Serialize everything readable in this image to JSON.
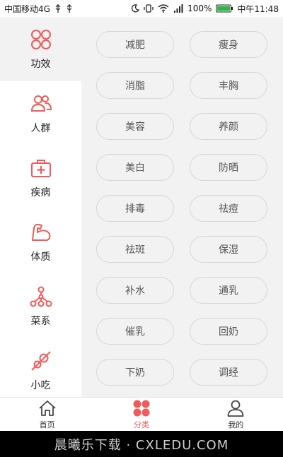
{
  "status_bar": {
    "carrier": "中国移动4G",
    "battery": "100%",
    "time": "中午11:48"
  },
  "sidebar": {
    "items": [
      {
        "label": "功效",
        "icon": "grid-circles-icon",
        "active": true
      },
      {
        "label": "人群",
        "icon": "people-icon"
      },
      {
        "label": "疾病",
        "icon": "medical-kit-icon"
      },
      {
        "label": "体质",
        "icon": "muscle-arm-icon"
      },
      {
        "label": "菜系",
        "icon": "network-tree-icon"
      },
      {
        "label": "小吃",
        "icon": "skewer-snack-icon"
      }
    ]
  },
  "tags": [
    "减肥",
    "瘦身",
    "消脂",
    "丰胸",
    "美容",
    "养颜",
    "美白",
    "防晒",
    "排毒",
    "祛痘",
    "祛斑",
    "保湿",
    "补水",
    "通乳",
    "催乳",
    "回奶",
    "下奶",
    "调经"
  ],
  "tabbar": {
    "items": [
      {
        "label": "首页",
        "icon": "home-icon"
      },
      {
        "label": "分类",
        "icon": "category-icon",
        "active": true
      },
      {
        "label": "我的",
        "icon": "user-icon"
      }
    ]
  },
  "watermark": "晨曦乐下载 · CXLEDU.COM",
  "colors": {
    "accent": "#f05a5a",
    "panel_bg": "#f2f2f2"
  }
}
